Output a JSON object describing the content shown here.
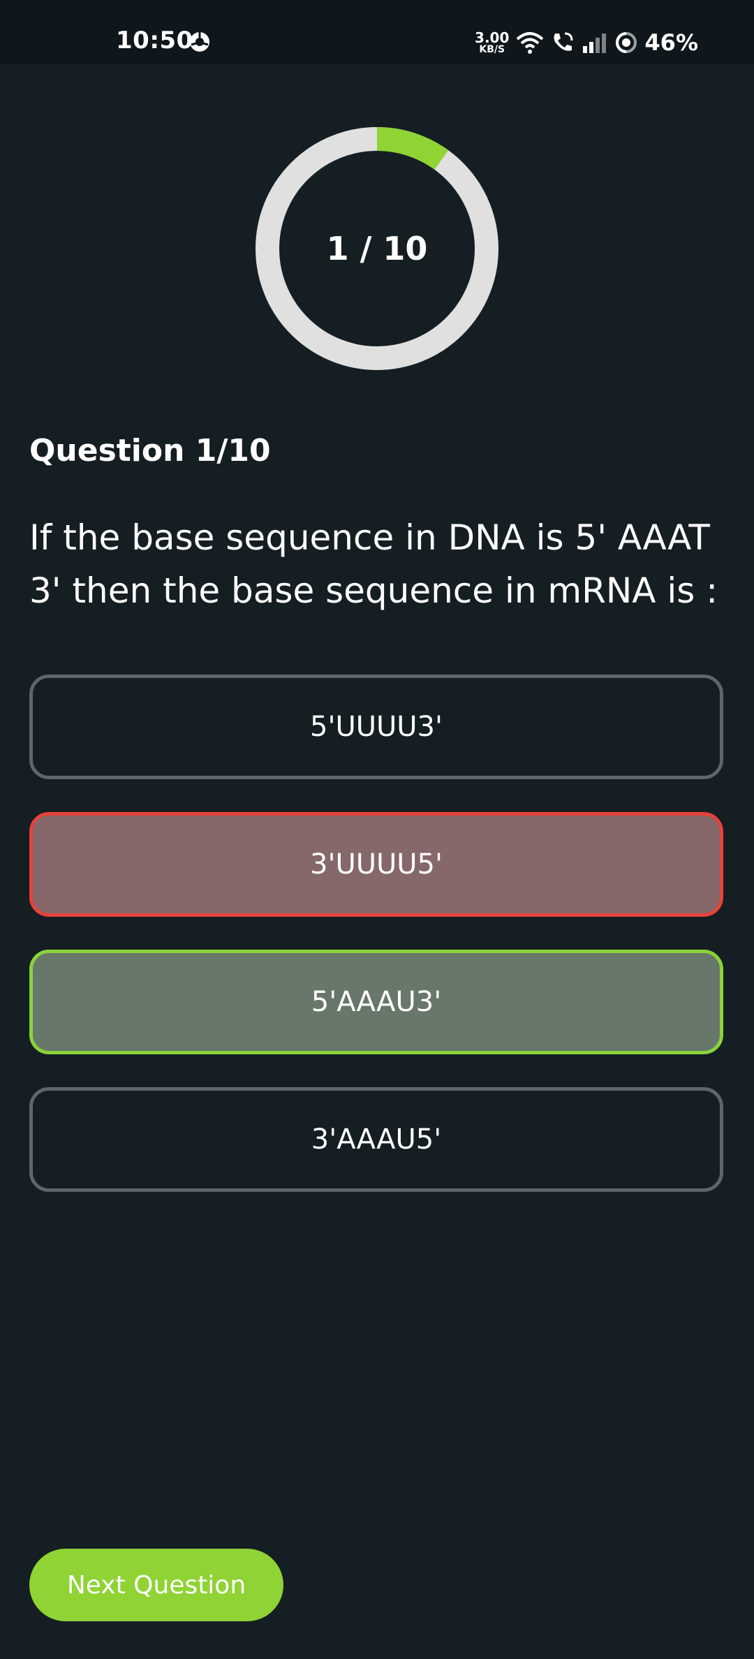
{
  "status_bar": {
    "time": "10:50",
    "net_speed_value": "3.00",
    "net_speed_unit": "KB/S",
    "battery": "46%"
  },
  "progress": {
    "label": "1 / 10",
    "current": 1,
    "total": 10,
    "fraction": 0.1,
    "fill_color": "#8fd334",
    "track_color": "#e0e0e0"
  },
  "question": {
    "label": "Question 1/10",
    "text": "If the base sequence in DNA is 5' AAAT 3' then the base sequence in mRNA is :"
  },
  "options": [
    {
      "label": "5'UUUU3'",
      "state": "default"
    },
    {
      "label": "3'UUUU5'",
      "state": "wrong"
    },
    {
      "label": "5'AAAU3'",
      "state": "correct"
    },
    {
      "label": "3'AAAU5'",
      "state": "default"
    }
  ],
  "colors": {
    "background": "#151e23",
    "wrong_border": "#e7423b",
    "correct_border": "#8bd33a",
    "accent": "#8fd334"
  },
  "next_button": {
    "label": "Next Question"
  }
}
